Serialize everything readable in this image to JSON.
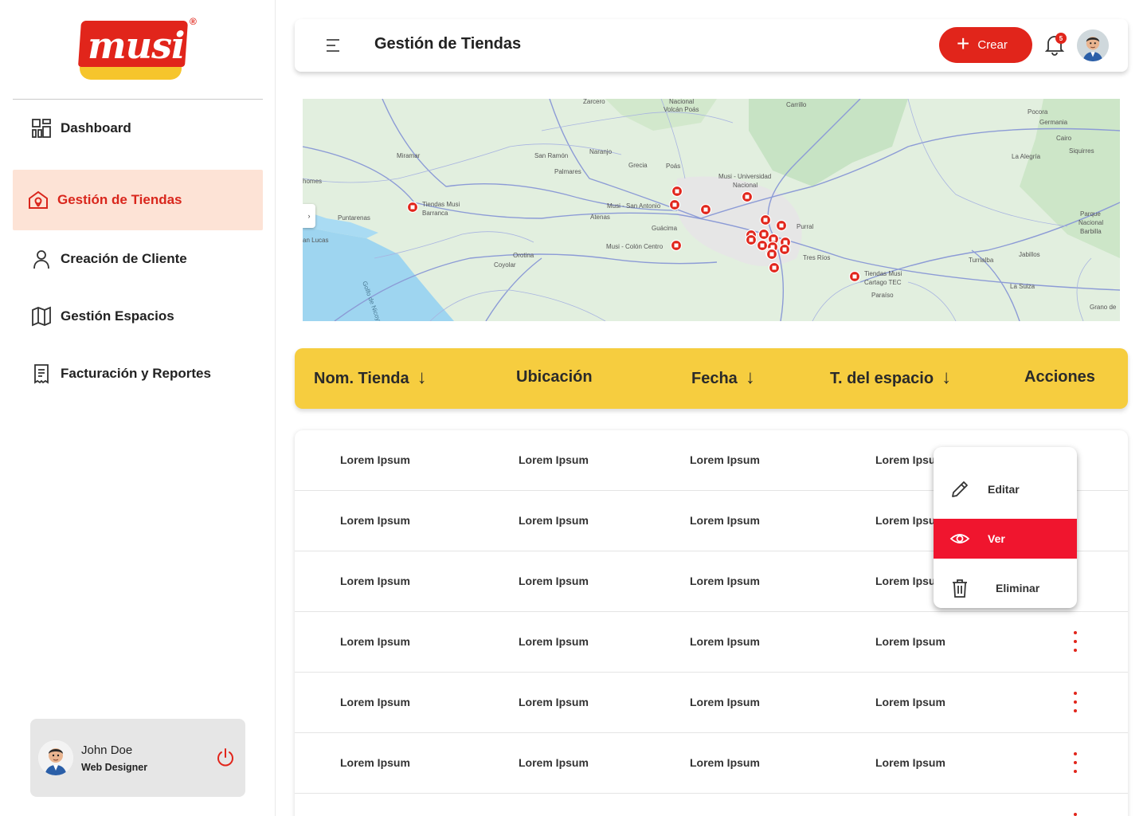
{
  "brand": {
    "logo_text": "musi",
    "registered_mark": "®"
  },
  "sidebar": {
    "items": [
      {
        "label": "Dashboard"
      },
      {
        "label": "Gestión de Tiendas"
      },
      {
        "label": "Creación de Cliente"
      },
      {
        "label": "Gestión Espacios"
      },
      {
        "label": "Facturación y Reportes"
      }
    ],
    "active_index": 1,
    "user": {
      "name": "John Doe",
      "role": "Web Designer"
    }
  },
  "header": {
    "title": "Gestión de Tiendas",
    "create_label": "Crear",
    "notification_count": "5"
  },
  "map": {
    "places": [
      "Zarcero",
      "Nacional Volcán Poás",
      "Carrillo",
      "Pocora",
      "Germania",
      "Cairo",
      "Siquirres",
      "La Alegría",
      "San Ramón",
      "Naranjo",
      "Miramar",
      "Palmares",
      "Grecia",
      "Poás",
      "Musi - Universidad Nacional",
      "Tiendas Musi Barranca",
      "Puntarenas",
      "Musi - San Antonio",
      "Atenas",
      "Guácima",
      "Purral",
      "Parque Nacional Barbilla",
      "Musi - Colón Centro",
      "Orotina",
      "Coyolar",
      "Tres Ríos",
      "Tiendas Musi Cartago TEC",
      "Turrialba",
      "Jabillos",
      "Paraíso",
      "La Suiza",
      "Grano de",
      "Golfo de Nicoya",
      "homes",
      "an Lucas"
    ],
    "store_pin_count": 20
  },
  "table": {
    "columns": [
      {
        "label": "Nom. Tienda",
        "sortable": true
      },
      {
        "label": "Ubicación",
        "sortable": false
      },
      {
        "label": "Fecha",
        "sortable": true
      },
      {
        "label": "T. del espacio",
        "sortable": true
      },
      {
        "label": "Acciones",
        "sortable": false
      }
    ],
    "rows": [
      [
        "Lorem Ipsum",
        "Lorem Ipsum",
        "Lorem Ipsum",
        "Lorem Ipsum"
      ],
      [
        "Lorem Ipsum",
        "Lorem Ipsum",
        "Lorem Ipsum",
        "Lorem Ipsum"
      ],
      [
        "Lorem Ipsum",
        "Lorem Ipsum",
        "Lorem Ipsum",
        "Lorem Ipsum"
      ],
      [
        "Lorem Ipsum",
        "Lorem Ipsum",
        "Lorem Ipsum",
        "Lorem Ipsum"
      ],
      [
        "Lorem Ipsum",
        "Lorem Ipsum",
        "Lorem Ipsum",
        "Lorem Ipsum"
      ],
      [
        "Lorem Ipsum",
        "Lorem Ipsum",
        "Lorem Ipsum",
        "Lorem Ipsum"
      ]
    ],
    "sort_arrow": "↓"
  },
  "action_menu": {
    "items": [
      {
        "label": "Editar",
        "icon": "pencil-icon"
      },
      {
        "label": "Ver",
        "icon": "eye-icon"
      },
      {
        "label": "Eliminar",
        "icon": "trash-icon"
      }
    ],
    "active_index": 1
  },
  "colors": {
    "brand_red": "#e1251b",
    "brand_yellow": "#f6cd3f",
    "active_nav_bg": "#fde3d6",
    "menu_active": "#f0152e"
  }
}
